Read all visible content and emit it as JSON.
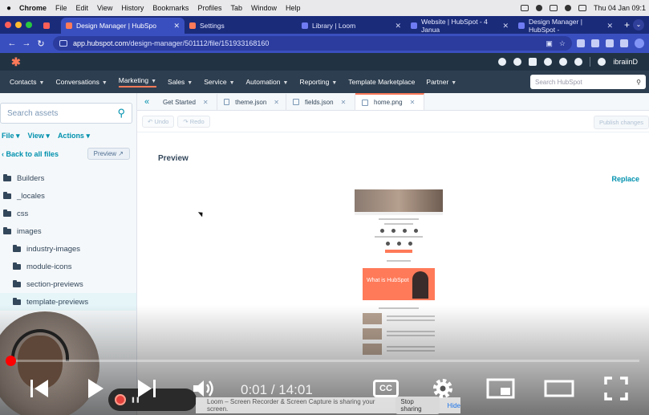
{
  "macos": {
    "app": "Chrome",
    "menus": [
      "File",
      "Edit",
      "View",
      "History",
      "Bookmarks",
      "Profiles",
      "Tab",
      "Window",
      "Help"
    ],
    "clock": "Thu 04 Jan  09:1"
  },
  "browser": {
    "tabs": [
      {
        "label": "Design Manager | HubSpo",
        "active": true
      },
      {
        "label": "Settings",
        "active": false
      },
      {
        "label": "Library | Loom",
        "active": false
      },
      {
        "label": "Website | HubSpot - 4 Janua",
        "active": false
      },
      {
        "label": "Design Manager | HubSpot -",
        "active": false
      }
    ],
    "url_host": "app.hubspot.com",
    "url_path": "/design-manager/501112/file/151933168160"
  },
  "hubspot": {
    "account_label": "ibraiinD",
    "nav": [
      "Contacts",
      "Conversations",
      "Marketing",
      "Sales",
      "Service",
      "Automation",
      "Reporting",
      "Template Marketplace",
      "Partner"
    ],
    "search_placeholder": "Search HubSpot"
  },
  "sidebar": {
    "search_placeholder": "Search assets",
    "menus": [
      "File",
      "View",
      "Actions"
    ],
    "back_label": "Back to all files",
    "preview_label": "Preview",
    "tree": [
      {
        "label": "Builders",
        "level": 0
      },
      {
        "label": "_locales",
        "level": 0
      },
      {
        "label": "css",
        "level": 0
      },
      {
        "label": "images",
        "level": 0
      },
      {
        "label": "industry-images",
        "level": 1
      },
      {
        "label": "module-icons",
        "level": 1
      },
      {
        "label": "section-previews",
        "level": 1
      },
      {
        "label": "template-previews",
        "level": 1,
        "selected": true
      }
    ]
  },
  "editor": {
    "tabs": [
      {
        "label": "Get Started"
      },
      {
        "label": "theme.json"
      },
      {
        "label": "fields.json"
      },
      {
        "label": "home.png",
        "active": true
      }
    ],
    "undo_label": "Undo",
    "redo_label": "Redo",
    "publish_label": "Publish changes",
    "preview_title": "Preview",
    "replace_label": "Replace",
    "thumb_text": "What is HubSpot"
  },
  "video": {
    "time_current": "0:01",
    "time_total": "14:01",
    "progress": 0.001,
    "cc_label": "CC"
  },
  "screen_share": {
    "message": "Loom – Screen Recorder & Screen Capture is sharing your screen.",
    "stop_label": "Stop sharing",
    "hide_label": "Hide"
  }
}
